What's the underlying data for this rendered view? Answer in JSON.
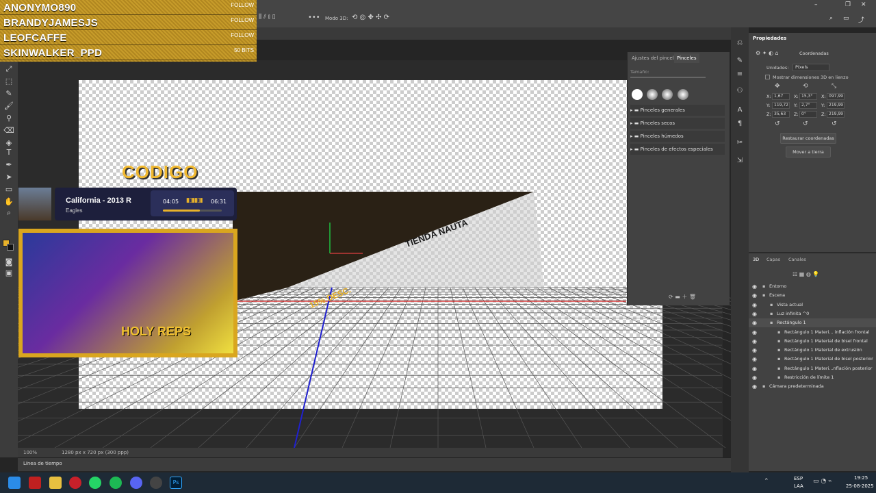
{
  "stream": {
    "follows": [
      {
        "name": "ANONYMO890",
        "tag": "FOLLOW"
      },
      {
        "name": "BRANDYJAMESJS",
        "tag": "FOLLOW"
      },
      {
        "name": "LEOFCAFFE",
        "tag": "FOLLOW"
      },
      {
        "name": "SKINWALKER_PPD",
        "tag": "50 BITS"
      }
    ],
    "music": {
      "title": "California - 2013 R",
      "artist": "Eagles",
      "elapsed": "04:05",
      "total": "06:31",
      "progress": 0.63
    },
    "canvas_text": {
      "codigo": "CODIGO",
      "tienda": "TIENDA NAUTA",
      "desc": "15% DESC.",
      "logo": "HOLY REPS"
    }
  },
  "optionbar": {
    "mode3d_label": "Modo 3D:"
  },
  "brush_panel": {
    "tabs": [
      "Ajustes del pincel",
      "Pinceles"
    ],
    "size_label": "Tamaño:",
    "folders": [
      "Pinceles generales",
      "Pinceles secos",
      "Pinceles húmedos",
      "Pinceles de efectos especiales"
    ]
  },
  "properties": {
    "title": "Propiedades",
    "section": "Coordenadas",
    "units_label": "Unidades:",
    "units_value": "Píxels",
    "show_3d": "Mostrar dimensiones 3D en lienzo",
    "rows": [
      {
        "a_label": "X:",
        "a": "1,67",
        "b_label": "X:",
        "b": "15,3°",
        "c_label": "X:",
        "c": "097,99"
      },
      {
        "a_label": "Y:",
        "a": "119,72",
        "b_label": "Y:",
        "b": "2,7°",
        "c_label": "Y:",
        "c": "219,99"
      },
      {
        "a_label": "Z:",
        "a": "35,63",
        "b_label": "Z:",
        "b": "0°",
        "c_label": "Z:",
        "c": "219,99"
      }
    ],
    "restore_btn": "Restaurar coordenadas",
    "ground_btn": "Mover a tierra"
  },
  "layers_panel": {
    "tabs": [
      "3D",
      "Capas",
      "Canales"
    ],
    "items": [
      {
        "label": "Entorno",
        "indent": 0
      },
      {
        "label": "Escena",
        "indent": 0
      },
      {
        "label": "Vista actual",
        "indent": 1
      },
      {
        "label": "Luz infinita ^0",
        "indent": 1
      },
      {
        "label": "Rectángulo 1",
        "indent": 1
      },
      {
        "label": "Rectángulo 1 Materi... inflación frontal",
        "indent": 2
      },
      {
        "label": "Rectángulo 1 Material de bisel frontal",
        "indent": 2
      },
      {
        "label": "Rectángulo 1 Material de extrusión",
        "indent": 2
      },
      {
        "label": "Rectángulo 1 Material de bisel posterior",
        "indent": 2
      },
      {
        "label": "Rectángulo 1 Materi...nflación posterior",
        "indent": 2
      },
      {
        "label": "Restricción de límite 1",
        "indent": 2
      },
      {
        "label": "Cámara predeterminada",
        "indent": 0
      }
    ]
  },
  "statusbar": {
    "zoom": "100%",
    "doc": "1280 px x 720 px (300 ppp)"
  },
  "timeline": {
    "label": "Línea de tiempo"
  },
  "taskbar": {
    "lang1": "ESP",
    "lang2": "LAA",
    "time": "19:25",
    "date": "25-08-2025"
  },
  "colors": {
    "accent": "#31a8ff",
    "gold": "#e8b22a",
    "panel": "#424242"
  }
}
